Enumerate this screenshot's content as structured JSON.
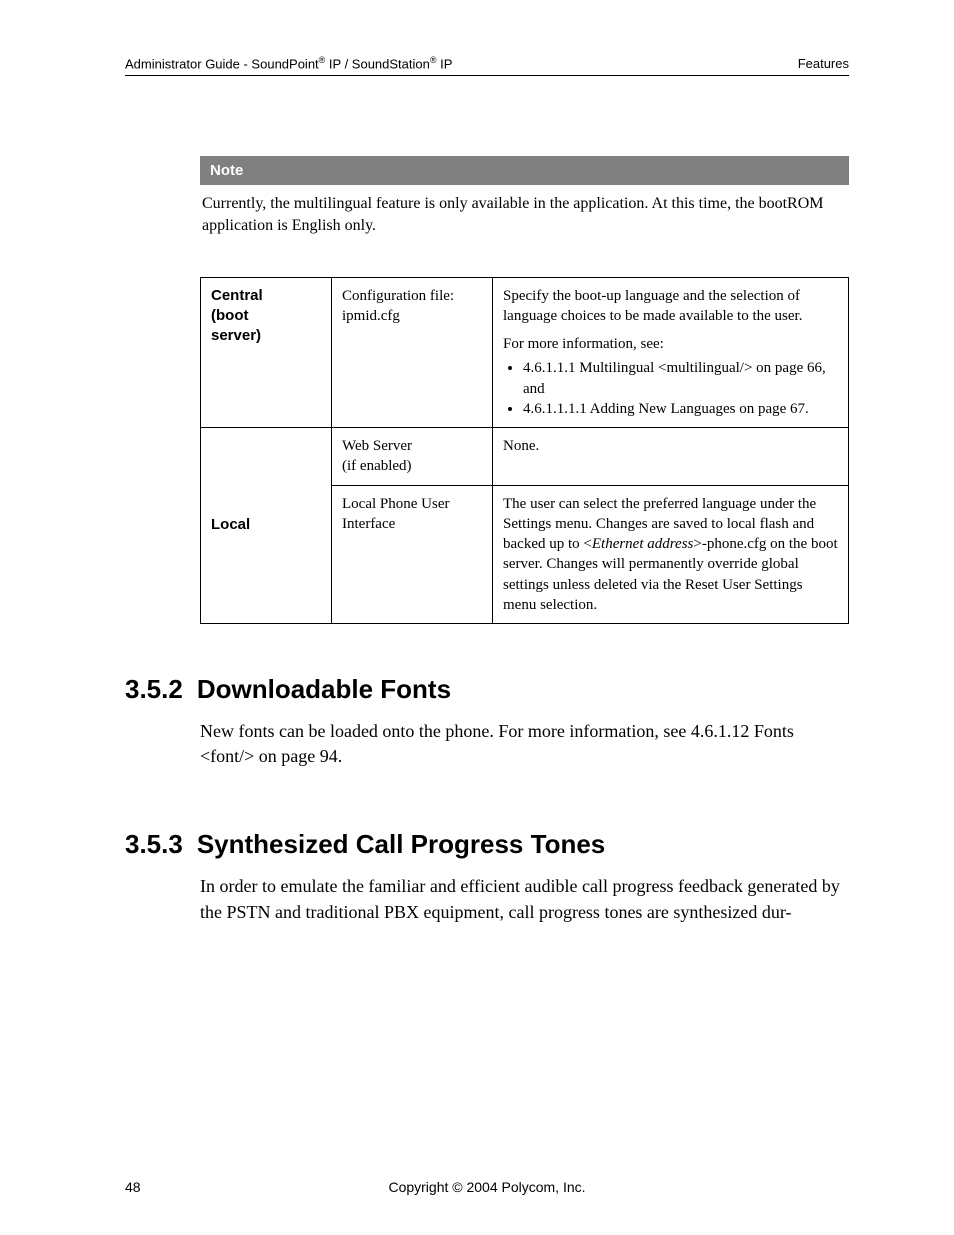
{
  "header": {
    "left_prefix": "Administrator Guide - SoundPoint",
    "reg": "®",
    "left_mid": " IP / SoundStation",
    "left_suffix": " IP",
    "right": "Features"
  },
  "note": {
    "label": "Note",
    "body": "Currently, the multilingual feature is only available in the application.  At this time, the bootROM application is English only."
  },
  "table": {
    "r1_label_a": "Central",
    "r1_label_b": "(boot",
    "r1_label_c": "server)",
    "r1_col2_a": "Configuration file:",
    "r1_col2_b": "ipmid.cfg",
    "r1_col3_a": "Specify the boot-up language and the selection of language choices to be made available to the user.",
    "r1_col3_b": "For more information, see:",
    "r1_bullet1": "4.6.1.1.1 Multilingual <multilingual/> on page 66, and",
    "r1_bullet2": "4.6.1.1.1.1 Adding New Languages on page 67.",
    "r2_label": "Local",
    "r2a_col2_a": "Web Server",
    "r2a_col2_b": "(if enabled)",
    "r2a_col3": "None.",
    "r2b_col2_a": "Local Phone User",
    "r2b_col2_b": "Interface",
    "r2b_col3_pre": "The user can select the preferred language under the Settings menu.  Changes are saved to local flash and backed up to <",
    "r2b_col3_ital": "Ethernet address",
    "r2b_col3_post": ">-phone.cfg on the boot server.  Changes will permanently override global settings unless deleted via the Reset User Settings menu selection."
  },
  "sec352": {
    "num": "3.5.2",
    "title": "Downloadable Fonts",
    "body": "New fonts can be loaded onto the phone.  For more information, see 4.6.1.12 Fonts <font/> on page 94."
  },
  "sec353": {
    "num": "3.5.3",
    "title": "Synthesized Call Progress Tones",
    "body": "In order to emulate the familiar and efficient audible call progress feedback generated by the PSTN and traditional PBX equipment, call progress tones are synthesized dur-"
  },
  "footer": {
    "page": "48",
    "copyright": "Copyright © 2004 Polycom, Inc."
  }
}
